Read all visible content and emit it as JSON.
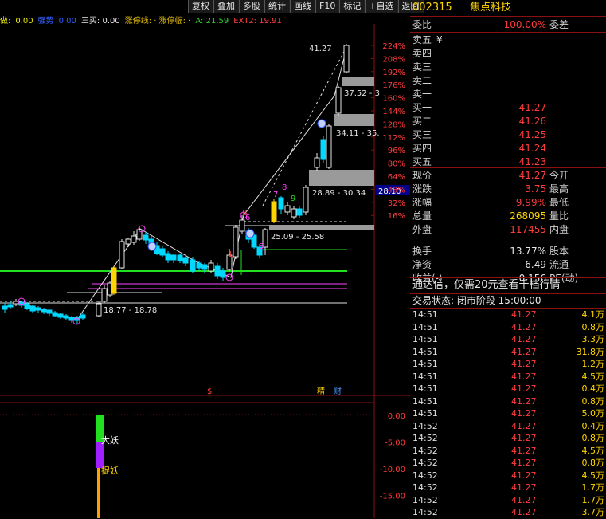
{
  "toolbar": [
    "复权",
    "叠加",
    "多股",
    "统计",
    "画线",
    "F10",
    "标记",
    "+自选",
    "返回"
  ],
  "indicator_line": [
    {
      "text": "做:",
      "color": "#e8e800"
    },
    {
      "text": "0.00",
      "color": "#e8e800"
    },
    {
      "text": "强势",
      "color": "#3060ff"
    },
    {
      "text": "0.00",
      "color": "#3060ff"
    },
    {
      "text": "三买: 0.00",
      "color": "#e6e6e6"
    },
    {
      "text": "涨停线: · 涨停幅: ·",
      "color": "#e8c000"
    },
    {
      "text": "A: 21.59",
      "color": "#30d030"
    },
    {
      "text": "EXT2: 19.91",
      "color": "#ff4040"
    }
  ],
  "colors": {
    "up": "#ff3c3c",
    "down": "#00d8ff",
    "yellow": "#ffd500",
    "green": "#20e020",
    "magenta": "#ff40ff",
    "white": "#e6e6e6",
    "gray": "#808080",
    "blue_hl": "#000088"
  },
  "price_axis": [
    "224%",
    "208%",
    "192%",
    "176%",
    "160%",
    "144%",
    "128%",
    "112%",
    "96%",
    "80%",
    "64%",
    "48%",
    "32%",
    "16%"
  ],
  "current_price_label": "28.10",
  "indicator_axis": [
    "0.00",
    "-5.00",
    "-10.00",
    "-15.00"
  ],
  "annotations": {
    "peak": "41.27",
    "box1": "37.52 - 3",
    "box2": "34.11 - 35.",
    "box3": "28.89 - 30.34",
    "box4": "25.09 - 25.58",
    "box5": "18.77 - 18.78",
    "numbers": [
      "7",
      "8",
      "9",
      "6",
      "1",
      "8",
      "5"
    ],
    "time_markers": [
      "$",
      "精",
      "财"
    ],
    "signal1": "大妖",
    "signal2": "捉妖"
  },
  "quote": {
    "code": "002315",
    "name": "焦点科技",
    "weibi_label": "委比",
    "weibi": "100.00%",
    "weicha_label": "委差",
    "sell_labels": [
      "卖五",
      "卖四",
      "卖三",
      "卖二",
      "卖一"
    ],
    "sell5_symbol": "¥",
    "buy": [
      {
        "label": "买一",
        "price": "41.27"
      },
      {
        "label": "买二",
        "price": "41.26"
      },
      {
        "label": "买三",
        "price": "41.25"
      },
      {
        "label": "买四",
        "price": "41.24"
      },
      {
        "label": "买五",
        "price": "41.23"
      }
    ],
    "stats": [
      {
        "label": "现价",
        "value": "41.27",
        "label2": "今开",
        "color": "#ff3c3c"
      },
      {
        "label": "涨跌",
        "value": "3.75",
        "label2": "最高",
        "color": "#ff3c3c"
      },
      {
        "label": "涨幅",
        "value": "9.99%",
        "label2": "最低",
        "color": "#ff3c3c"
      },
      {
        "label": "总量",
        "value": "268095",
        "label2": "量比",
        "color": "#ffd500"
      },
      {
        "label": "外盘",
        "value": "117455",
        "label2": "内盘",
        "color": "#ff3c3c"
      },
      {
        "label": "换手",
        "value": "13.77%",
        "label2": "股本",
        "color": "#e6e6e6"
      },
      {
        "label": "净资",
        "value": "6.49",
        "label2": "流通",
        "color": "#e6e6e6"
      },
      {
        "label": "收益(-)",
        "value": "0.156",
        "label2": "PE(动)",
        "color": "#e6e6e6"
      }
    ],
    "banner": "通达信，仅需20元查看千档行情",
    "trade_status": "交易状态: 闭市阶段 15:00:00",
    "ticks": [
      {
        "t": "14:51",
        "p": "41.27",
        "v": "4.1万"
      },
      {
        "t": "14:51",
        "p": "41.27",
        "v": "0.8万"
      },
      {
        "t": "14:51",
        "p": "41.27",
        "v": "3.3万"
      },
      {
        "t": "14:51",
        "p": "41.27",
        "v": "31.8万"
      },
      {
        "t": "14:51",
        "p": "41.27",
        "v": "1.2万"
      },
      {
        "t": "14:51",
        "p": "41.27",
        "v": "4.5万"
      },
      {
        "t": "14:51",
        "p": "41.27",
        "v": "0.4万"
      },
      {
        "t": "14:51",
        "p": "41.27",
        "v": "0.8万"
      },
      {
        "t": "14:51",
        "p": "41.27",
        "v": "5.0万"
      },
      {
        "t": "14:52",
        "p": "41.27",
        "v": "0.4万"
      },
      {
        "t": "14:52",
        "p": "41.27",
        "v": "0.8万"
      },
      {
        "t": "14:52",
        "p": "41.27",
        "v": "4.5万"
      },
      {
        "t": "14:52",
        "p": "41.27",
        "v": "0.8万"
      },
      {
        "t": "14:52",
        "p": "41.27",
        "v": "4.5万"
      },
      {
        "t": "14:52",
        "p": "41.27",
        "v": "1.7万"
      },
      {
        "t": "14:52",
        "p": "41.27",
        "v": "1.7万"
      },
      {
        "t": "14:52",
        "p": "41.27",
        "v": "3.7万"
      }
    ]
  }
}
